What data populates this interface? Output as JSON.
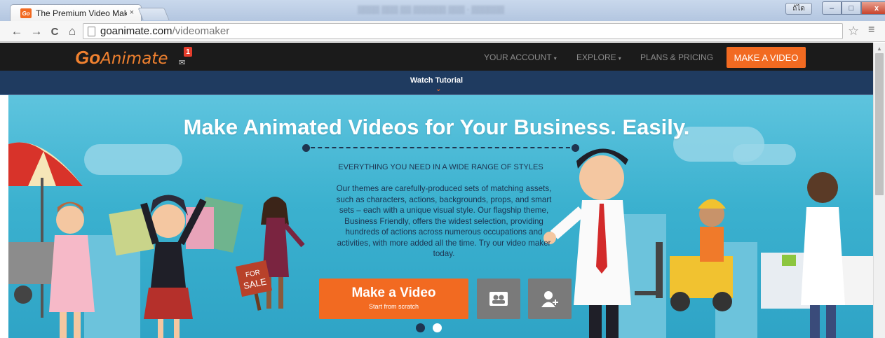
{
  "browser": {
    "tab_title": "The Premium Video Make",
    "tab_favicon": "Go",
    "close_tab": "×",
    "window_user": "ถ้ได",
    "blurred_window_title": "▒▒▒▒ ▒▒▒ ▒▒ ▒▒▒▒▒▒ ▒▒▒ · ▒▒▒▒▒▒",
    "url_domain": "goanimate.com",
    "url_path": "/videomaker",
    "back": "←",
    "forward": "→",
    "reload": "C",
    "home": "⌂",
    "star": "☆",
    "menu": "≡",
    "minimize": "–",
    "maximize": "□",
    "close": "x"
  },
  "site": {
    "logo_go": "Go",
    "logo_rest": "Animate",
    "notification_count": "1",
    "mail_glyph": "✉",
    "nav": {
      "account": "YOUR ACCOUNT",
      "explore": "EXPLORE",
      "pricing": "PLANS & PRICING",
      "cta": "MAKE A VIDEO",
      "caret": "▾"
    },
    "tutorial": "Watch Tutorial",
    "tutorial_chevron": "⌄"
  },
  "hero": {
    "title": "Make Animated Videos for Your Business. Easily.",
    "subtitle": "EVERYTHING YOU NEED IN A WIDE RANGE OF STYLES",
    "description": "Our themes are carefully-produced sets of matching assets, such as characters, actions, backgrounds, props, and smart sets – each with a unique visual style. Our flagship theme, Business Friendly, offers the widest selection, providing hundreds of actions across numerous occupations and activities, with more added all the time. Try our video maker today.",
    "cta_label": "Make a Video",
    "cta_sub": "Start from scratch",
    "sign_text_1": "FOR",
    "sign_text_2": "SALE",
    "slide_count": 2,
    "active_slide": 1
  },
  "colors": {
    "brand_orange": "#f26a21",
    "nav_dark": "#1b1b1b",
    "tutorial_bar": "#1f3b60",
    "hero_sky": "#3bb1cf"
  }
}
